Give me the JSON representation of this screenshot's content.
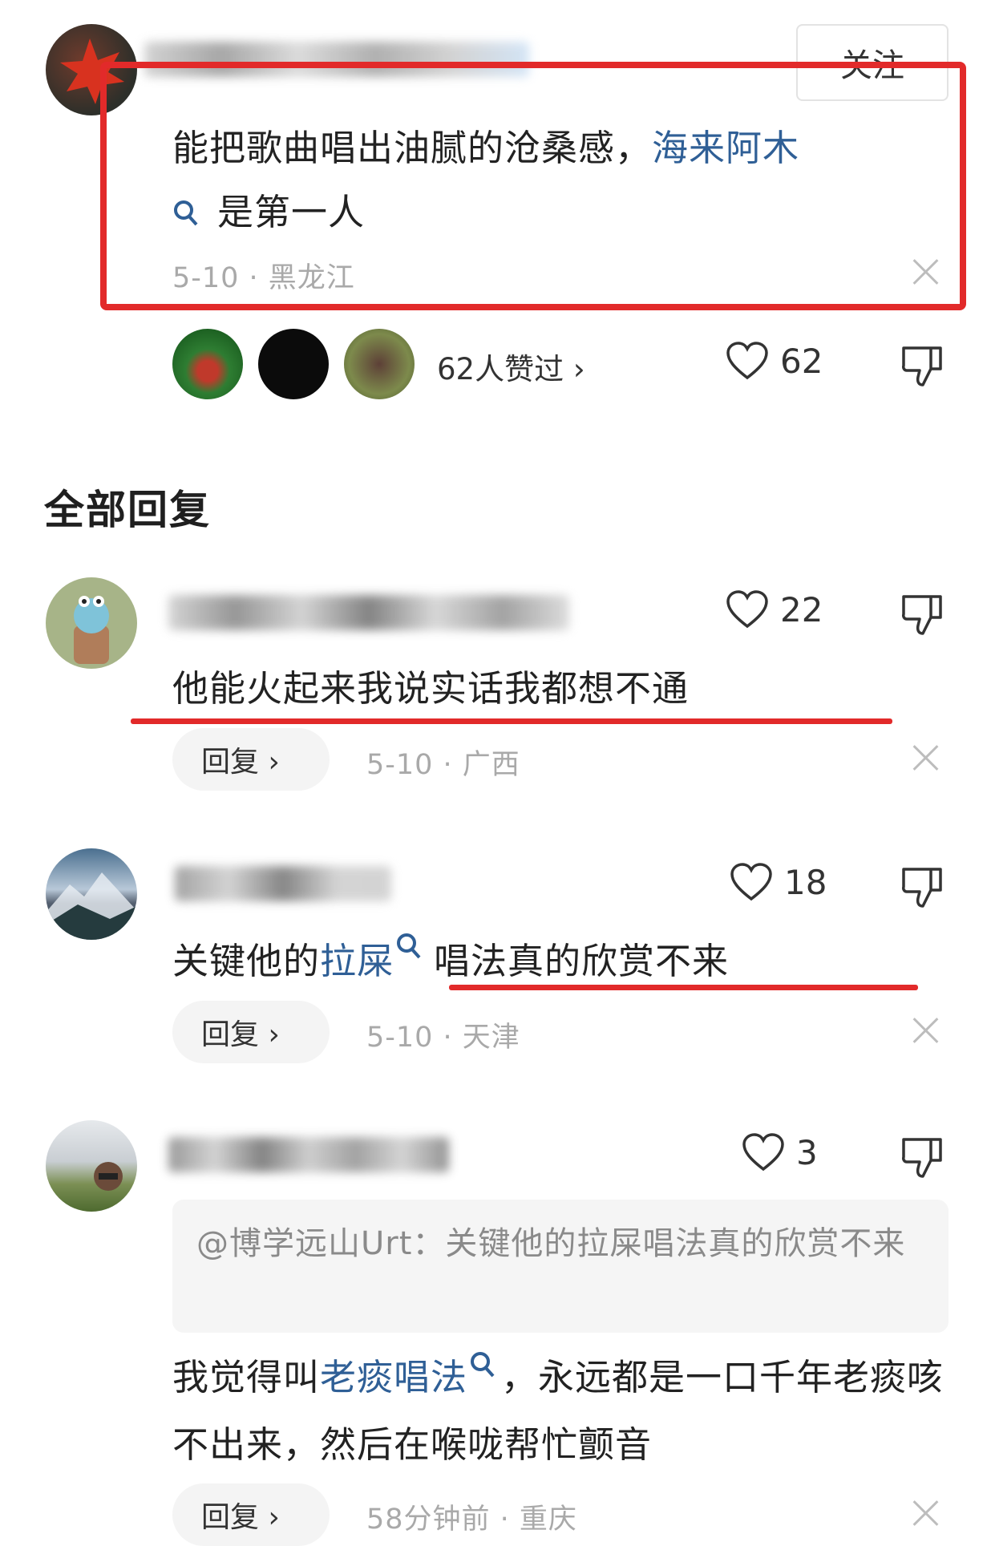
{
  "top_comment": {
    "follow_label": "关注",
    "text_before": "能把歌曲唱出油腻的沧桑感，",
    "link_1": "海来阿木",
    "text_after": "是第一人",
    "meta": "5-10 · 黑龙江",
    "likers_text": "62人赞过 ›",
    "like_count": "62"
  },
  "section_title": "全部回复",
  "replies": [
    {
      "like_count": "22",
      "text": "他能火起来我说实话我都想不通",
      "reply_label": "回复 ›",
      "meta": "5-10 · 广西"
    },
    {
      "like_count": "18",
      "text_before": "关键他的",
      "link": "拉屎",
      "text_after": "唱法真的欣赏不来",
      "reply_label": "回复 ›",
      "meta": "5-10 · 天津"
    },
    {
      "like_count": "3",
      "quote": "@博学远山Urt：关键他的拉屎唱法真的欣赏不来",
      "text_before": "我觉得叫",
      "link": "老痰唱法",
      "text_after": "，永远都是一口千年老痰咳不出来，然后在喉咙帮忙颤音",
      "reply_label": "回复 ›",
      "meta": "58分钟前 · 重庆"
    }
  ],
  "colors": {
    "link": "#2f5f96",
    "highlight": "#e22a2a",
    "meta": "#a9a9a9"
  }
}
